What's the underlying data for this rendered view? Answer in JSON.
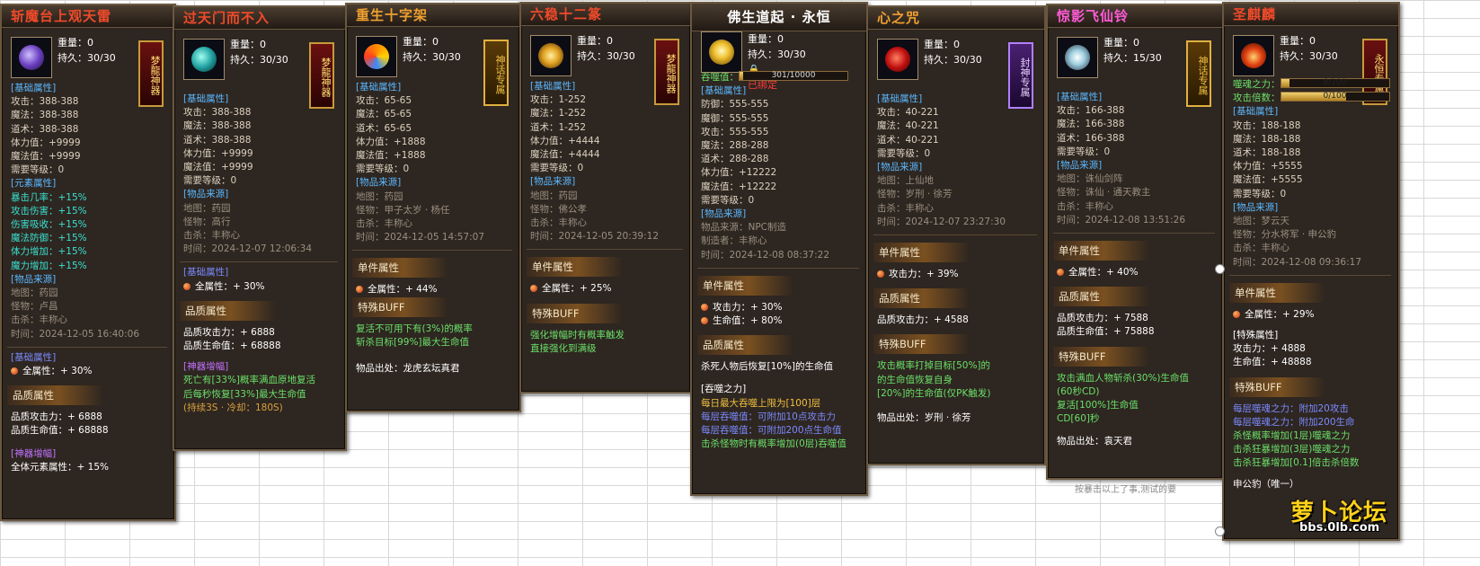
{
  "panels": [
    {
      "title": "斩魔台上观天雷",
      "weight": "重量：0",
      "durability": "持久：30/30",
      "badge": "梦龍神器",
      "lines": [
        "[基础属性]",
        "攻击：388-388",
        "魔法：388-388",
        "道术：388-388",
        "体力值：+9999",
        "魔法值：+9999",
        "需要等级：0",
        "[元素属性]",
        "暴击几率：+15%",
        "攻击伤害：+15%",
        "伤害吸收：+15%",
        "魔法防御：+15%",
        "体力增加：+15%",
        "魔力增加：+15%",
        "[物品来源]",
        "地图：药园",
        "怪物：卢昌",
        "击杀：丰称心",
        "时间：2024-12-05 16:40:06",
        "[基础属性]",
        "全属性：+ 30%",
        "品质属性",
        "品质攻击力：+ 6888",
        "品质生命值：+ 68888",
        "[神器增幅]",
        "全体元素属性：+ 15%"
      ]
    },
    {
      "title": "过天门而不入",
      "weight": "重量：0",
      "durability": "持久：30/30",
      "badge": "梦龍神器",
      "lines": [
        "[基础属性]",
        "攻击：388-388",
        "魔法：388-388",
        "道术：388-388",
        "体力值：+9999",
        "魔法值：+9999",
        "需要等级：0",
        "[物品来源]",
        "地图：药园",
        "怪物：高行",
        "击杀：丰称心",
        "时间：2024-12-07 12:06:34",
        "[基础属性]",
        "全属性：+ 30%",
        "品质属性",
        "品质攻击力：+ 6888",
        "品质生命值：+ 68888",
        "[神器增幅]",
        "死亡有[33%]概率满血原地复活",
        "后每秒恢复[33%]最大生命值",
        "(持续3S · 冷却：180S)"
      ]
    },
    {
      "title": "重生十字架",
      "weight": "重量：0",
      "durability": "持久：30/30",
      "badge": "神话专属",
      "lines": [
        "[基础属性]",
        "攻击：65-65",
        "魔法：65-65",
        "道术：65-65",
        "体力值：+1888",
        "魔法值：+1888",
        "需要等级：0",
        "[物品来源]",
        "地图：药园",
        "怪物：甲子太岁 · 杨任",
        "击杀：丰称心",
        "时间：2024-12-05 14:57:07",
        "单件属性",
        "全属性：+ 44%",
        "特殊BUFF",
        "复活不可用下有(3%)的概率",
        "斩杀目标[99%]最大生命值",
        "物品出处：龙虎玄坛真君"
      ]
    },
    {
      "title": "六稳十二篆",
      "weight": "重量：0",
      "durability": "持久：30/30",
      "badge": "梦龍神器",
      "lines": [
        "[基础属性]",
        "攻击：1-252",
        "魔法：1-252",
        "道术：1-252",
        "体力值：+4444",
        "魔法值：+4444",
        "需要等级：0",
        "[物品来源]",
        "地图：药园",
        "怪物：佛公孝",
        "击杀：丰称心",
        "时间：2024-12-05 20:39:12",
        "单件属性",
        "全属性：+ 25%",
        "特殊BUFF",
        "强化增幅时有概率触发",
        "直接强化到满级"
      ]
    },
    {
      "title": "佛生道起 · 永恒",
      "weight": "重量：0",
      "durability": "持久：30/30",
      "bound": "已绑定",
      "devour_label": "吞噬值：",
      "devour_value": "301/10000",
      "devour_fraction": 0.03,
      "lines": [
        "[基础属性]",
        "防御：555-555",
        "魔御：555-555",
        "攻击：555-555",
        "魔法：288-288",
        "道术：288-288",
        "体力值：+12222",
        "魔法值：+12222",
        "需要等级：0",
        "[物品来源]",
        "物品来源：NPC制造",
        "制造者：丰称心",
        "时间：2024-12-08 08:37:22",
        "单件属性",
        "攻击力：+ 30%",
        "生命值：+ 80%",
        "品质属性",
        "杀死人物后恢复[10%]的生命值",
        "[吞噬之力]",
        "每日最大吞噬上限为[100]层",
        "每层吞噬值：可附加10点攻击力",
        "每层吞噬值：可附加200点生命值",
        "击杀怪物时有概率增加(0层)吞噬值"
      ]
    },
    {
      "title": "心之咒",
      "weight": "重量：0",
      "durability": "持久：30/30",
      "badge": "封神专属",
      "lines": [
        "[基础属性]",
        "攻击：40-221",
        "魔法：40-221",
        "道术：40-221",
        "需要等级：0",
        "[物品来源]",
        "地图：上仙地",
        "怪物：岁刑 · 徐芳",
        "击杀：丰称心",
        "时间：2024-12-07 23:27:30",
        "单件属性",
        "攻击力：+ 39%",
        "品质属性",
        "品质攻击力：+ 4588",
        "特殊BUFF",
        "攻击概率打掉目标[50%]的",
        "的生命值恢复自身",
        "[20%]的生命值(仅PK触发)",
        "物品出处：岁刑 · 徐芳"
      ]
    },
    {
      "title": "惊影飞仙铃",
      "weight": "重量：0",
      "durability": "持久：15/30",
      "badge": "神话专属",
      "lines": [
        "[基础属性]",
        "攻击：166-388",
        "魔法：166-388",
        "道术：166-388",
        "需要等级：0",
        "[物品来源]",
        "地图：诛仙剑阵",
        "怪物：诛仙 · 通天教主",
        "击杀：丰称心",
        "时间：2024-12-08 13:51:26",
        "单件属性",
        "全属性：+ 40%",
        "品质属性",
        "品质攻击力：+ 7588",
        "品质生命值：+ 75888",
        "特殊BUFF",
        "攻击满血人物斩杀(30%)生命值",
        "(60秒CD)",
        "复活[100%]生命值",
        "CD[60]秒",
        "物品出处：袁天君"
      ]
    },
    {
      "title": "圣麒麟",
      "weight": "重量：0",
      "durability": "持久：30/30",
      "badge": "永恒专属",
      "bars": [
        {
          "label": "噬魂之力：",
          "value": "8/100",
          "fraction": 0.08
        },
        {
          "label": "攻击倍数：",
          "value": "0/100",
          "fraction": 0.6
        }
      ],
      "lines": [
        "[基础属性]",
        "攻击：188-188",
        "魔法：188-188",
        "道术：188-188",
        "体力值：+5555",
        "魔法值：+5555",
        "需要等级：0",
        "[物品来源]",
        "地图：梦云天",
        "怪物：分水将军 · 申公豹",
        "击杀：丰称心",
        "时间：2024-12-08 09:36:17",
        "单件属性",
        "全属性：+ 29%",
        "[特殊属性]",
        "攻击力：+ 4888",
        "生命值：+ 48888",
        "特殊BUFF",
        "每层噬魂之力：附加20攻击",
        "每层噬魂之力：附加200生命",
        "杀怪概率增加(1层)噬魂之力",
        "击杀狂暴增加(3层)噬魂之力",
        "击杀狂暴增加[0.1]倍击杀倍数",
        "申公豹（唯一）"
      ]
    }
  ],
  "watermark": {
    "logo": "萝卜论坛",
    "url": "bbs.0lb.com"
  },
  "under_text": "按暴击以上了事,测试的要"
}
